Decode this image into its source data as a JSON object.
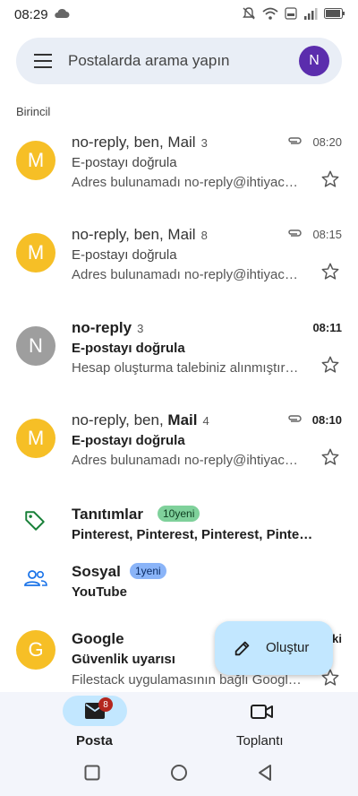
{
  "status": {
    "time": "08:29"
  },
  "search": {
    "placeholder": "Postalarda arama yapın",
    "avatar_letter": "N"
  },
  "section": {
    "label": "Birincil"
  },
  "emails": [
    {
      "avatar": "M",
      "sender": "no-reply, ben, Mail",
      "count": "3",
      "time": "08:20",
      "subject": "E-postayı doğrula",
      "snippet": "Adres bulunamadı no-reply@ihtiyac…"
    },
    {
      "avatar": "M",
      "sender": "no-reply, ben, Mail",
      "count": "8",
      "time": "08:15",
      "subject": "E-postayı doğrula",
      "snippet": "Adres bulunamadı no-reply@ihtiyac…"
    },
    {
      "avatar": "N",
      "sender": "no-reply",
      "count": "3",
      "time": "08:11",
      "subject": "E-postayı doğrula",
      "snippet": "Hesap oluşturma talebiniz alınmıştır…"
    },
    {
      "avatar": "M",
      "sender_prefix": "no-reply, ben, ",
      "sender_bold": "Mail",
      "count": "4",
      "time": "08:10",
      "subject": "E-postayı doğrula",
      "snippet": "Adres bulunamadı no-reply@ihtiyac…"
    },
    {
      "avatar": "G",
      "sender": "Google",
      "time_partial": "ki",
      "subject": "Güvenlik uyarısı",
      "snippet": "Filestack uygulamasının bağlı Googl…"
    }
  ],
  "categories": [
    {
      "title": "Tanıtımlar",
      "badge": "10yeni",
      "subtitle": "Pinterest, Pinterest, Pinterest, Pinte…"
    },
    {
      "title": "Sosyal",
      "badge": "1yeni",
      "subtitle": "YouTube"
    }
  ],
  "fab": {
    "label": "Oluştur"
  },
  "bottom_nav": {
    "mail_label": "Posta",
    "mail_badge": "8",
    "meet_label": "Toplantı"
  },
  "colors": {
    "accent": "#c2e7ff",
    "avatar_yellow": "#f6bf26",
    "avatar_gray": "#9e9e9e",
    "avatar_purple": "#5b2dad",
    "promo_badge": "#7fd19b",
    "social_badge": "#8ab4f8"
  }
}
